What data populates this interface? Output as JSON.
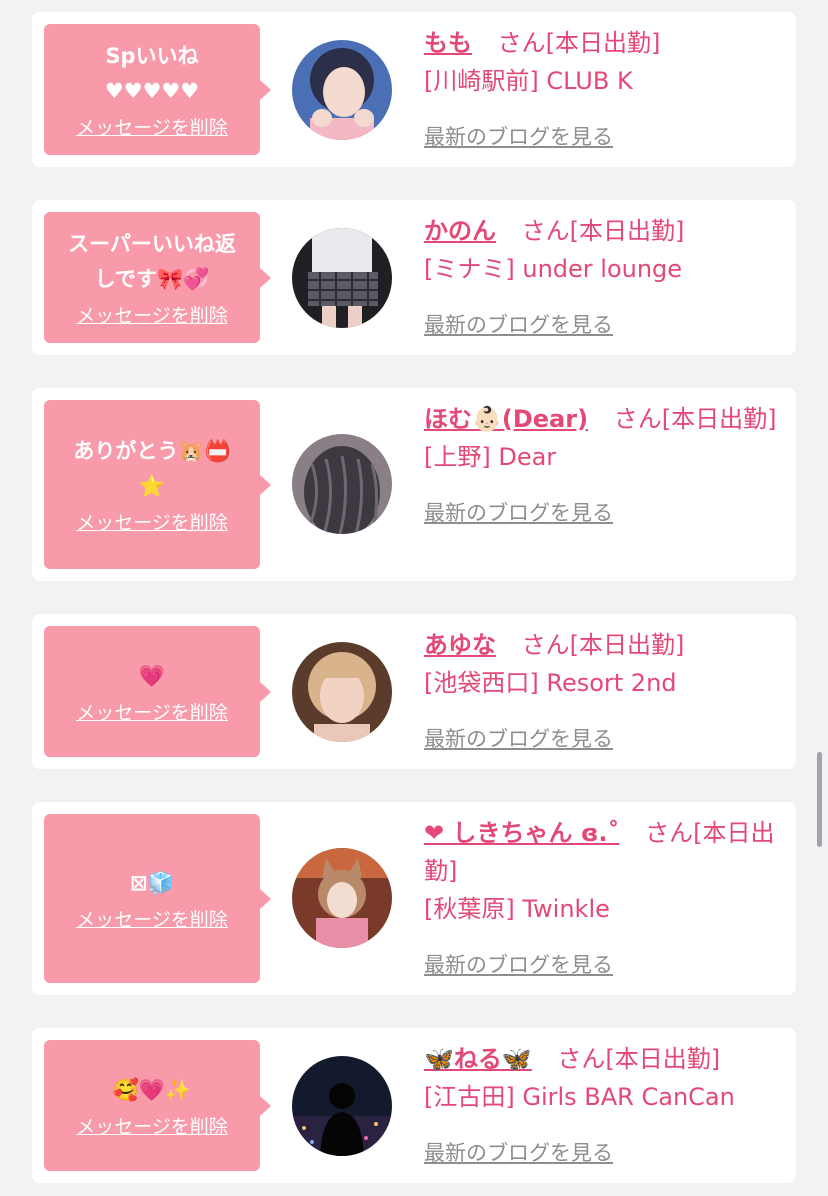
{
  "cards": [
    {
      "message": "Spいいね\n♥♥♥♥♥",
      "delete_label": "メッセージを削除",
      "name": "もも",
      "suffix": "さん[本日出勤]",
      "area_shop": "[川崎駅前] CLUB K",
      "blog_link": "最新のブログを見る",
      "avatar": "woman-portrait-pink"
    },
    {
      "message": "スーパーいいね返\nしです🎀💞",
      "delete_label": "メッセージを削除",
      "name": "かのん",
      "suffix": "さん[本日出勤]",
      "area_shop": "[ミナミ] under lounge",
      "blog_link": "最新のブログを見る",
      "avatar": "plaid-skirt-photo"
    },
    {
      "message": "ありがとう🐹📛\n⭐",
      "delete_label": "メッセージを削除",
      "name": "ほむ👶🏻(Dear)",
      "suffix": "さん[本日出勤]",
      "area_shop": "[上野] Dear",
      "blog_link": "最新のブログを見る",
      "avatar": "wavy-hair-photo"
    },
    {
      "message": "💗",
      "delete_label": "メッセージを削除",
      "name": "あゆな",
      "suffix": "さん[本日出勤]",
      "area_shop": "[池袋西口] Resort 2nd",
      "blog_link": "最新のブログを見る",
      "avatar": "blonde-woman-photo"
    },
    {
      "message": "⊠🧊",
      "delete_label": "メッセージを削除",
      "name": "❤ しきちゃん ɞ.˚",
      "suffix": "さん[本日出勤]",
      "area_shop": "[秋葉原] Twinkle",
      "blog_link": "最新のブログを見る",
      "avatar": "cat-ears-photo"
    },
    {
      "message": "🥰💗✨",
      "delete_label": "メッセージを削除",
      "name": "🦋ねる🦋",
      "suffix": "さん[本日出勤]",
      "area_shop": "[江古田] Girls BAR CanCan",
      "blog_link": "最新のブログを見る",
      "avatar": "night-city-silhouette"
    }
  ]
}
